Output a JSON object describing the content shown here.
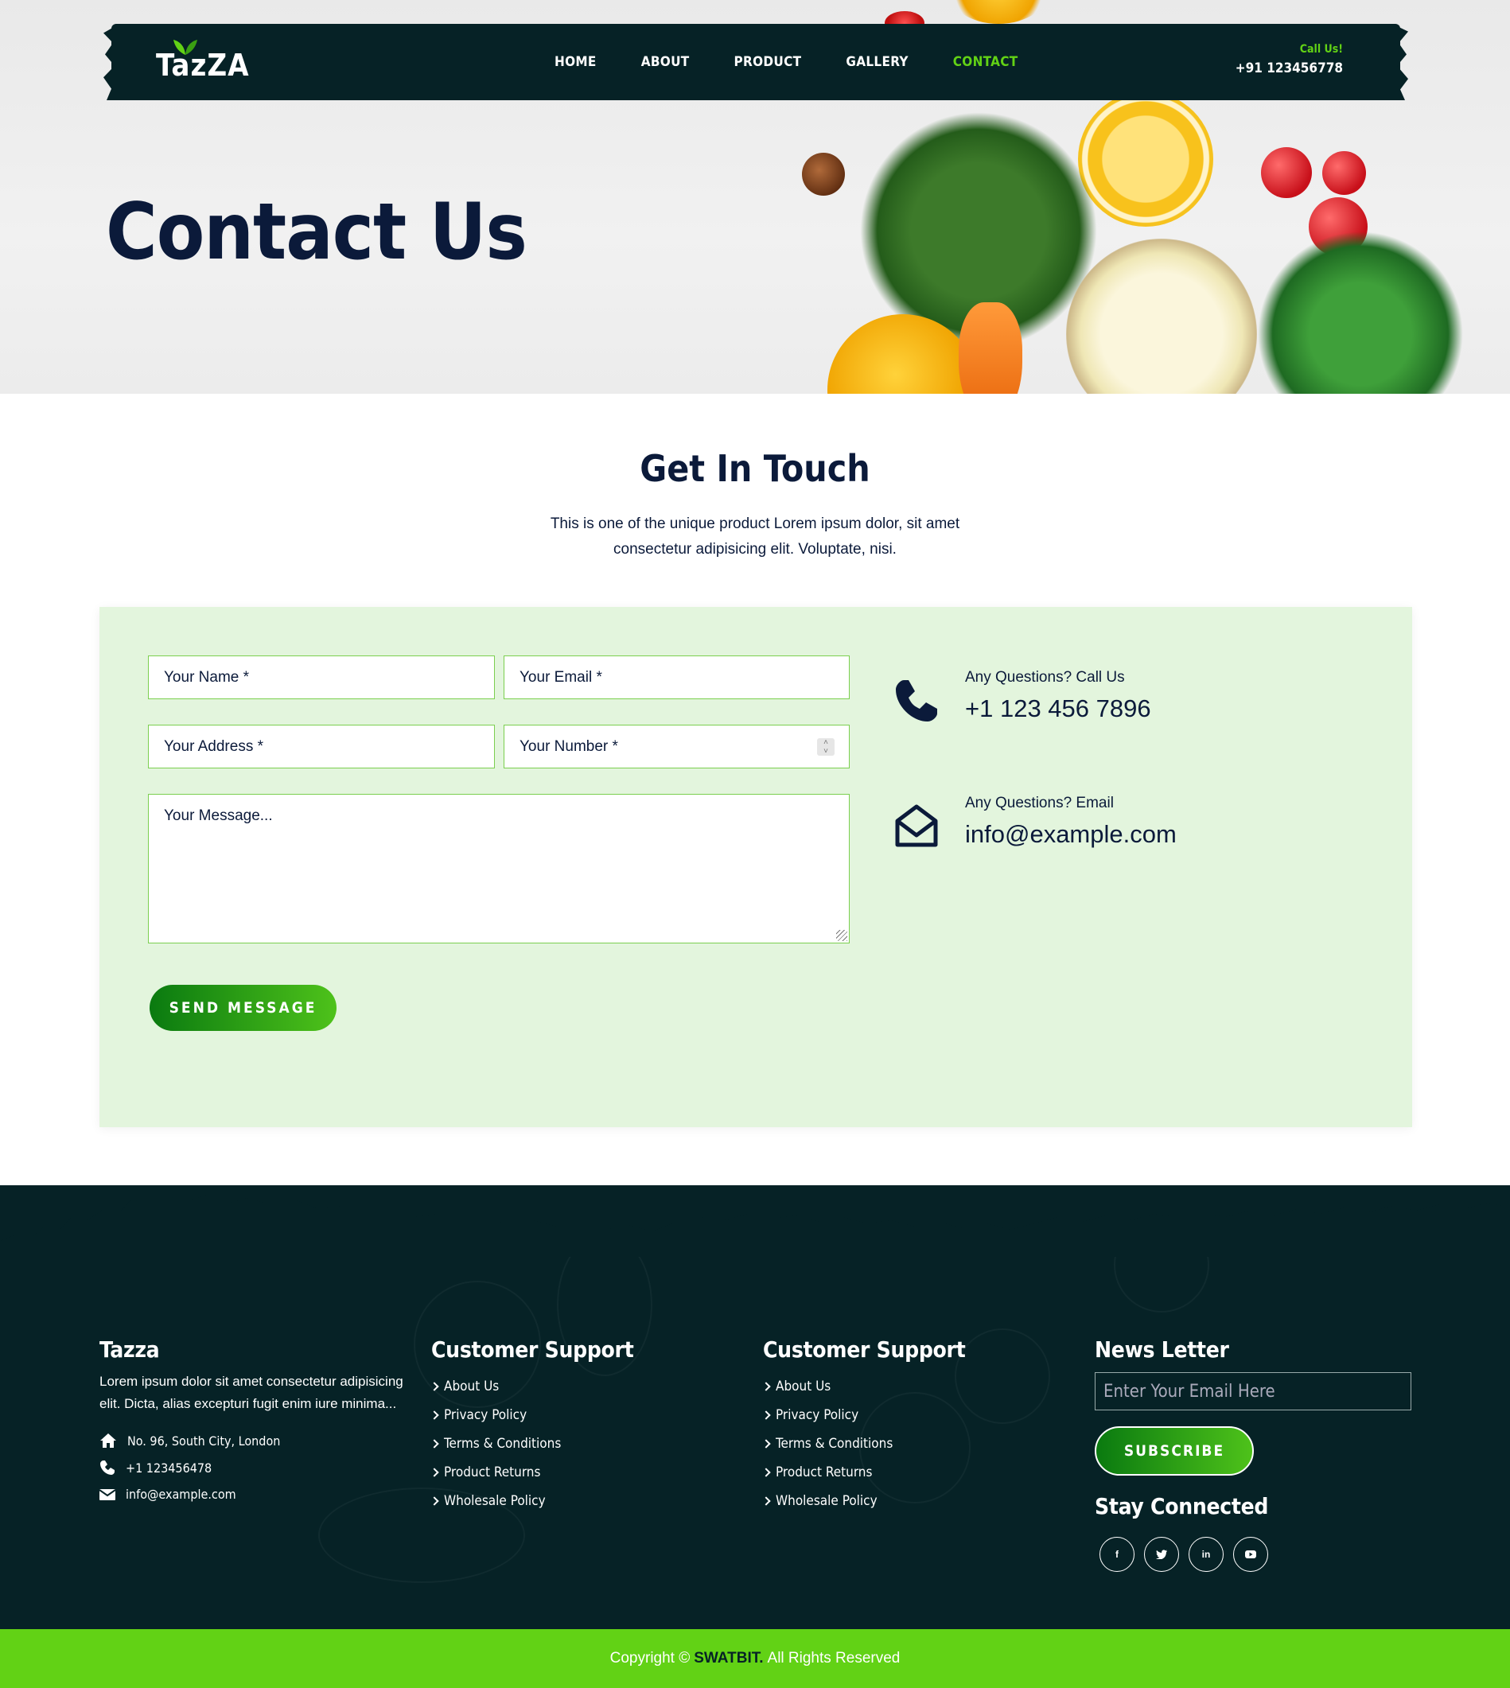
{
  "brand": {
    "logo": "TazZA"
  },
  "nav": {
    "items": [
      "HOME",
      "ABOUT",
      "PRODUCT",
      "GALLERY",
      "CONTACT"
    ],
    "active": "CONTACT"
  },
  "call": {
    "label": "Call Us!",
    "number": "+91 123456778"
  },
  "hero": {
    "title": "Contact Us"
  },
  "touch": {
    "title": "Get In Touch",
    "description": "This is one of the unique product Lorem ipsum dolor, sit amet consectetur adipisicing elit. Voluptate, nisi."
  },
  "form": {
    "name_placeholder": "Your Name *",
    "email_placeholder": "Your Email *",
    "address_placeholder": "Your Address *",
    "number_placeholder": "Your Number *",
    "message_placeholder": "Your Message...",
    "send_label": "SEND MESSAGE"
  },
  "contact_info": {
    "phone_label": "Any Questions? Call Us",
    "phone_value": "+1 123 456 7896",
    "email_label": "Any Questions? Email",
    "email_value": "info@example.com"
  },
  "footer": {
    "about": {
      "title": "Tazza",
      "text": "Lorem ipsum dolor sit amet consectetur adipisicing elit. Dicta, alias excepturi fugit enim iure minima...",
      "address": "No. 96, South City, London",
      "phone": "+1 123456478",
      "email": "info@example.com"
    },
    "support1": {
      "title": "Customer Support",
      "links": [
        "About Us",
        "Privacy Policy",
        "Terms & Conditions",
        "Product Returns",
        "Wholesale Policy"
      ]
    },
    "support2": {
      "title": "Customer Support",
      "links": [
        "About Us",
        "Privacy Policy",
        "Terms & Conditions",
        "Product Returns",
        "Wholesale Policy"
      ]
    },
    "newsletter": {
      "title": "News Letter",
      "placeholder": "Enter Your Email Here",
      "subscribe_label": "SUBSCRIBE",
      "stay_title": "Stay Connected",
      "social": [
        "f",
        "t",
        "in",
        "yt"
      ]
    }
  },
  "copyright": {
    "prefix": "Copyright ©",
    "brand": "SWATBIT.",
    "suffix": "All Rights Reserved"
  },
  "colors": {
    "dark": "#062226",
    "accent": "#62d215",
    "navy": "#0b1a3a",
    "panel": "#e3f5dd"
  }
}
